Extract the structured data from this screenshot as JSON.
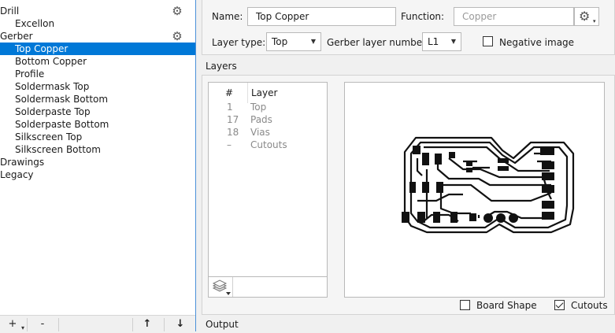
{
  "tree": {
    "items": [
      {
        "label": "Drill",
        "top": -1
      },
      {
        "label": "Excellon"
      },
      {
        "label": "Gerber"
      },
      {
        "label": "Top Copper",
        "selected": true
      },
      {
        "label": "Bottom Copper"
      },
      {
        "label": "Profile"
      },
      {
        "label": "Soldermask Top"
      },
      {
        "label": "Soldermask Bottom"
      },
      {
        "label": "Solderpaste Top"
      },
      {
        "label": "Solderpaste Bottom"
      },
      {
        "label": "Silkscreen Top"
      },
      {
        "label": "Silkscreen Bottom"
      },
      {
        "label": "Drawings"
      },
      {
        "label": "Legacy"
      }
    ]
  },
  "toolbar": {
    "add_label": "+",
    "remove_label": "-",
    "up_label": "↑",
    "down_label": "↓"
  },
  "props": {
    "name_label": "Name:",
    "name_value": "Top Copper",
    "function_label": "Function:",
    "function_placeholder": "Copper",
    "layer_type_label": "Layer type:",
    "layer_type_value": "Top",
    "gerber_number_label": "Gerber layer number:",
    "gerber_number_value": "L1",
    "negative_image_label": "Negative image",
    "negative_image_checked": false
  },
  "layers": {
    "caption": "Layers",
    "col_number": "#",
    "col_layer": "Layer",
    "rows": [
      {
        "num": "1",
        "name": "Top"
      },
      {
        "num": "17",
        "name": "Pads"
      },
      {
        "num": "18",
        "name": "Vias"
      },
      {
        "num": "–",
        "name": "Cutouts"
      }
    ]
  },
  "preview": {
    "board_shape_label": "Board Shape",
    "board_shape_checked": false,
    "cutouts_label": "Cutouts",
    "cutouts_checked": true
  },
  "output": {
    "caption": "Output"
  },
  "colors": {
    "selection": "#0078d7",
    "panel_border": "#4a90d9"
  }
}
